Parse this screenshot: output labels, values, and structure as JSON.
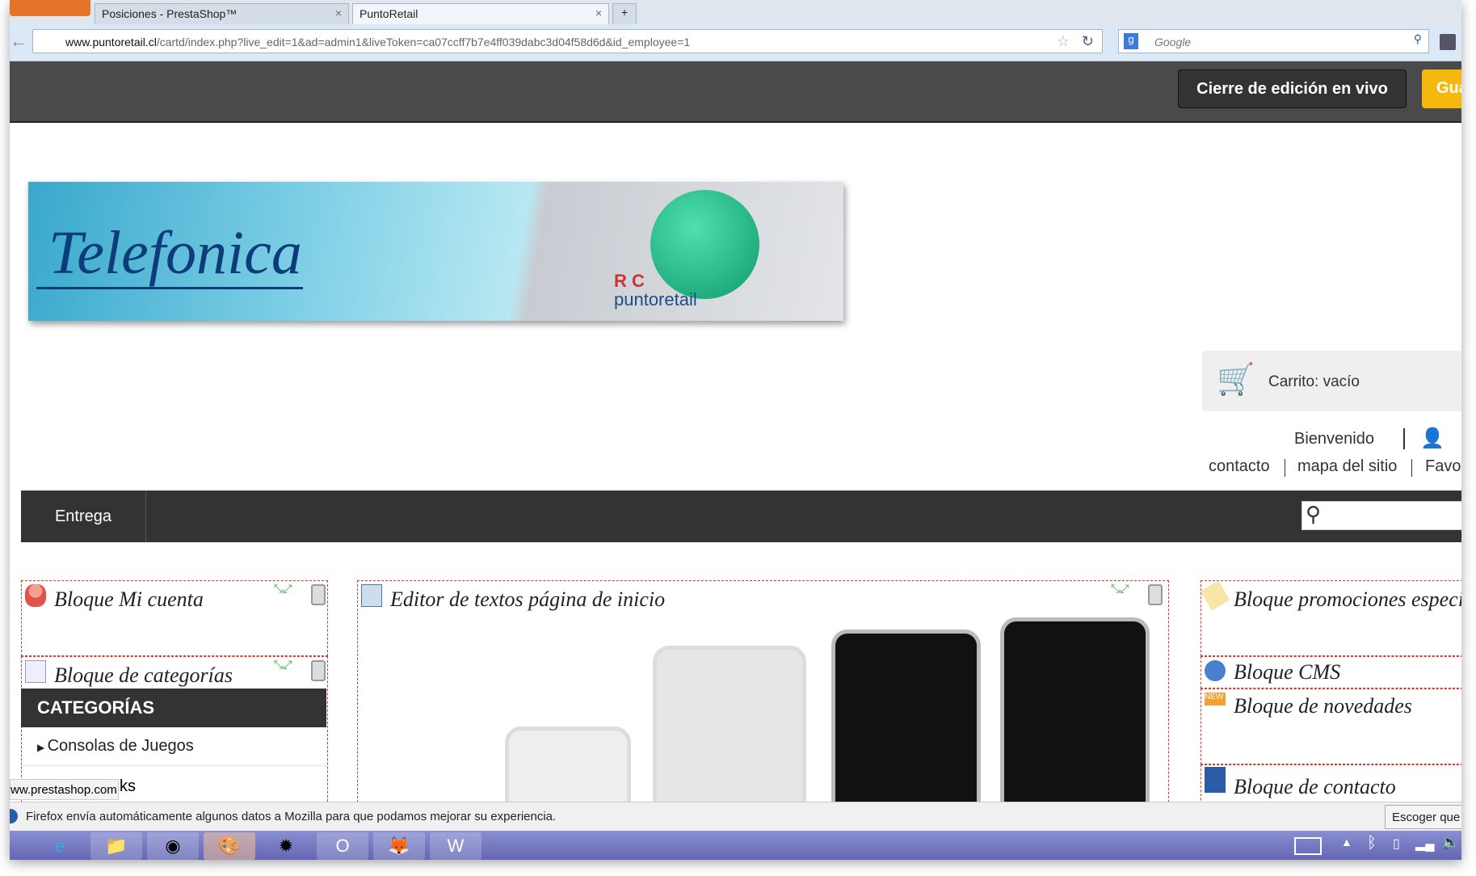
{
  "browser": {
    "firefox_button": "Firefox",
    "tabs": [
      {
        "label": "Posiciones - PrestaShop™"
      },
      {
        "label": "PuntoRetail"
      }
    ],
    "new_tab": "+",
    "url_domain": "www.puntoretail.cl",
    "url_path": "/cartd/index.php?live_edit=1&ad=admin1&liveToken=ca07ccff7b7e4ff039dabc3d04f58d6d&id_employee=1",
    "search_placeholder": "Google",
    "status_url": "ww.prestashop.com"
  },
  "admin_bar": {
    "close_live_edit": "Cierre de edición en vivo",
    "save": "Guardar"
  },
  "banner": {
    "brand": "Telefonica",
    "sub_brand_1": "R C",
    "sub_brand_2": "puntoretail"
  },
  "header": {
    "cart": "Carrito: vacío",
    "welcome": "Bienvenido",
    "links": [
      "contacto",
      "mapa del sitio",
      "Favoritos"
    ]
  },
  "nav": {
    "items": [
      "Entrega"
    ]
  },
  "blocks": {
    "left": [
      {
        "title": "Bloque Mi cuenta"
      },
      {
        "title": "Bloque de categorías"
      }
    ],
    "categories_heading": "CATEGORÍAS",
    "categories": [
      "Consolas de Juegos"
    ],
    "partial_text": "ks",
    "center": {
      "title": "Editor de textos página de inicio"
    },
    "right": [
      {
        "title": "Bloque promociones especiales"
      },
      {
        "title": "Bloque CMS"
      },
      {
        "title": "Bloque de novedades"
      },
      {
        "title": "Bloque de contacto"
      }
    ]
  },
  "notification": {
    "text": "Firefox envía automáticamente algunos datos a Mozilla para que podamos mejorar su experiencia.",
    "button": "Escoger que compartir"
  },
  "taskbar": {
    "apps": [
      "internet-explorer",
      "file-explorer",
      "chrome",
      "paint",
      "picasa",
      "outlook",
      "firefox",
      "word"
    ]
  }
}
